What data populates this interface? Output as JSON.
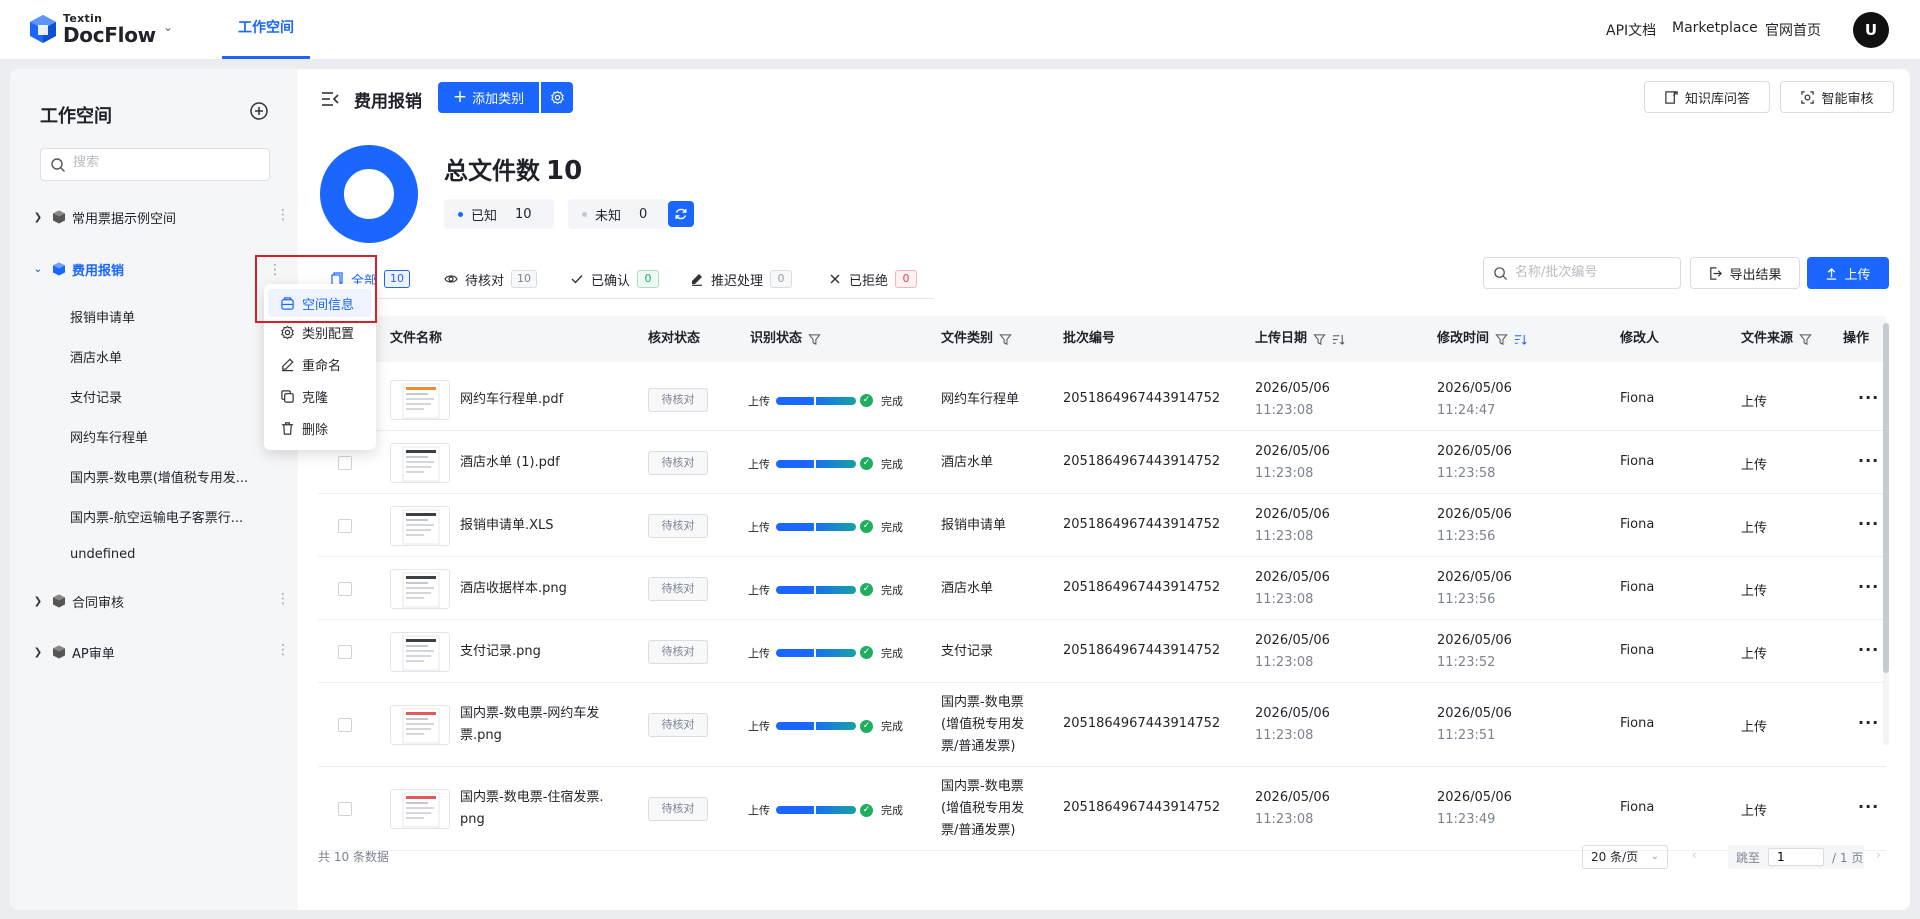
{
  "app": {
    "logo_small": "Textin",
    "logo_big": "DocFlow",
    "nav_tab": "工作空间",
    "top_links": [
      "API文档",
      "Marketplace",
      "官网首页"
    ],
    "avatar": "U",
    "accent": "#1a66ff"
  },
  "sidebar": {
    "title": "工作空间",
    "search_placeholder": "搜索",
    "groups": [
      {
        "label": "常用票据示例空间",
        "expanded": false
      },
      {
        "label": "费用报销",
        "expanded": true,
        "active": true
      },
      {
        "label": "合同审核",
        "expanded": false
      },
      {
        "label": "AP审单",
        "expanded": false
      }
    ],
    "sub_items": [
      "报销申请单",
      "酒店水单",
      "支付记录",
      "网约车行程单",
      "国内票-数电票(增值税专用发...",
      "国内票-航空运输电子客票行...",
      "undefined"
    ]
  },
  "context_menu": {
    "items": [
      "空间信息",
      "类别配置",
      "重命名",
      "克隆",
      "删除"
    ],
    "highlighted": "空间信息"
  },
  "header": {
    "title": "费用报销",
    "add_category": "添加类别",
    "knowledge_qa": "知识库问答",
    "smart_review": "智能审核"
  },
  "stats": {
    "total_label": "总文件数",
    "total": "10",
    "known_label": "已知",
    "known": "10",
    "unknown_label": "未知",
    "unknown": "0",
    "known_fraction": 1.0
  },
  "tabs": [
    {
      "label": "全部",
      "count": "10",
      "active": true
    },
    {
      "label": "待核对",
      "count": "10"
    },
    {
      "label": "已确认",
      "count": "0"
    },
    {
      "label": "推迟处理",
      "count": "0"
    },
    {
      "label": "已拒绝",
      "count": "0"
    }
  ],
  "toolbar": {
    "search_placeholder": "名称/批次编号",
    "export": "导出结果",
    "upload": "上传"
  },
  "table": {
    "columns": [
      "文件名称",
      "核对状态",
      "识别状态",
      "文件类别",
      "批次编号",
      "上传日期",
      "修改时间",
      "修改人",
      "文件来源",
      "操作"
    ],
    "rows": [
      {
        "name": [
          "网约车行程单.pdf"
        ],
        "review": "待核对",
        "rec_start": "上传",
        "rec_end": "完成",
        "category": [
          "网约车行程单"
        ],
        "batch": "2051864967443914752",
        "up_date": "2026/05/06",
        "up_time": "11:23:08",
        "mod_date": "2026/05/06",
        "mod_time": "11:24:47",
        "modifier": "Fiona",
        "source": "上传",
        "ops": "···"
      },
      {
        "name": [
          "酒店水单 (1).pdf"
        ],
        "review": "待核对",
        "rec_start": "上传",
        "rec_end": "完成",
        "category": [
          "酒店水单"
        ],
        "batch": "2051864967443914752",
        "up_date": "2026/05/06",
        "up_time": "11:23:08",
        "mod_date": "2026/05/06",
        "mod_time": "11:23:58",
        "modifier": "Fiona",
        "source": "上传",
        "ops": "···"
      },
      {
        "name": [
          "报销申请单.XLS"
        ],
        "review": "待核对",
        "rec_start": "上传",
        "rec_end": "完成",
        "category": [
          "报销申请单"
        ],
        "batch": "2051864967443914752",
        "up_date": "2026/05/06",
        "up_time": "11:23:08",
        "mod_date": "2026/05/06",
        "mod_time": "11:23:56",
        "modifier": "Fiona",
        "source": "上传",
        "ops": "···"
      },
      {
        "name": [
          "酒店收据样本.png"
        ],
        "review": "待核对",
        "rec_start": "上传",
        "rec_end": "完成",
        "category": [
          "酒店水单"
        ],
        "batch": "2051864967443914752",
        "up_date": "2026/05/06",
        "up_time": "11:23:08",
        "mod_date": "2026/05/06",
        "mod_time": "11:23:56",
        "modifier": "Fiona",
        "source": "上传",
        "ops": "···"
      },
      {
        "name": [
          "支付记录.png"
        ],
        "review": "待核对",
        "rec_start": "上传",
        "rec_end": "完成",
        "category": [
          "支付记录"
        ],
        "batch": "2051864967443914752",
        "up_date": "2026/05/06",
        "up_time": "11:23:08",
        "mod_date": "2026/05/06",
        "mod_time": "11:23:52",
        "modifier": "Fiona",
        "source": "上传",
        "ops": "···"
      },
      {
        "name": [
          "国内票-数电票-网约车发",
          "票.png"
        ],
        "review": "待核对",
        "rec_start": "上传",
        "rec_end": "完成",
        "category": [
          "国内票-数电票",
          "(增值税专用发",
          "票/普通发票)"
        ],
        "batch": "2051864967443914752",
        "up_date": "2026/05/06",
        "up_time": "11:23:08",
        "mod_date": "2026/05/06",
        "mod_time": "11:23:51",
        "modifier": "Fiona",
        "source": "上传",
        "ops": "···"
      },
      {
        "name": [
          "国内票-数电票-住宿发票.",
          "png"
        ],
        "review": "待核对",
        "rec_start": "上传",
        "rec_end": "完成",
        "category": [
          "国内票-数电票",
          "(增值税专用发",
          "票/普通发票)"
        ],
        "batch": "2051864967443914752",
        "up_date": "2026/05/06",
        "up_time": "11:23:08",
        "mod_date": "2026/05/06",
        "mod_time": "11:23:49",
        "modifier": "Fiona",
        "source": "上传",
        "ops": "···"
      }
    ]
  },
  "footer": {
    "total": "共 10 条数据",
    "page_size": "20 条/页",
    "jump_label": "跳至",
    "page": "1",
    "pages": "/ 1 页"
  }
}
